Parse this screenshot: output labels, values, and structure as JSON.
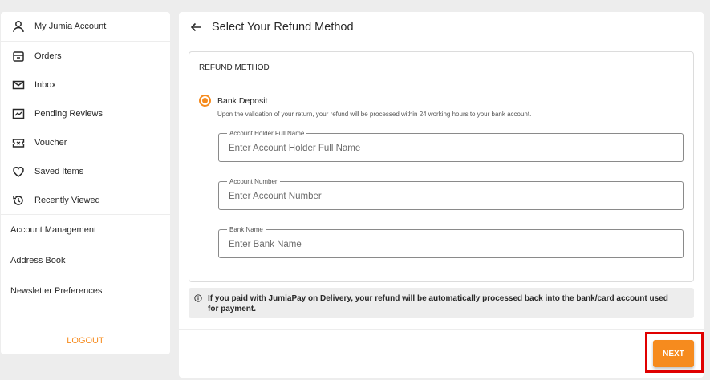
{
  "sidebar": {
    "items": [
      {
        "label": "My Jumia Account",
        "icon": "user-icon"
      },
      {
        "label": "Orders",
        "icon": "orders-icon"
      },
      {
        "label": "Inbox",
        "icon": "envelope-icon"
      },
      {
        "label": "Pending Reviews",
        "icon": "review-icon"
      },
      {
        "label": "Voucher",
        "icon": "voucher-icon"
      },
      {
        "label": "Saved Items",
        "icon": "heart-icon"
      },
      {
        "label": "Recently Viewed",
        "icon": "history-icon"
      }
    ],
    "links": [
      "Account Management",
      "Address Book",
      "Newsletter Preferences"
    ],
    "logout_label": "LOGOUT"
  },
  "main": {
    "title": "Select Your Refund Method",
    "section_title": "REFUND METHOD",
    "option_label": "Bank Deposit",
    "option_description": "Upon the validation of your return, your refund will be processed within 24 working hours to your bank account.",
    "fields": [
      {
        "label": "Account Holder Full Name",
        "placeholder": "Enter Account Holder Full Name",
        "value": ""
      },
      {
        "label": "Account Number",
        "placeholder": "Enter Account Number",
        "value": ""
      },
      {
        "label": "Bank Name",
        "placeholder": "Enter Bank Name",
        "value": ""
      }
    ],
    "note_line1": "If you paid with JumiaPay on Delivery, your refund will be automatically processed back into the bank/card account used",
    "note_line2": "for payment.",
    "next_label": "NEXT"
  },
  "colors": {
    "accent": "#f68b1e",
    "highlight": "#e00000",
    "background": "#ededed"
  }
}
